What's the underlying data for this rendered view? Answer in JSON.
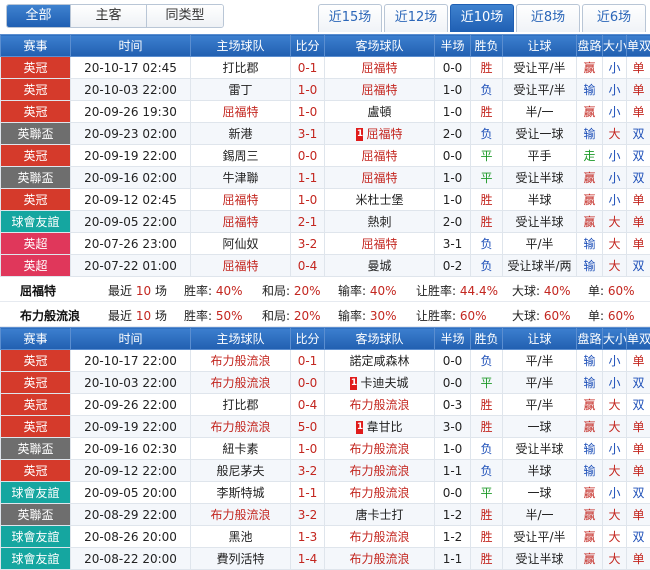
{
  "filters": {
    "scope": [
      "全部",
      "主客",
      "同类型"
    ],
    "active_scope": 0,
    "recent": [
      "近15场",
      "近12场",
      "近10场",
      "近8场",
      "近6场"
    ],
    "active_recent": 2
  },
  "headers": [
    "赛事",
    "时间",
    "主场球队",
    "比分",
    "客场球队",
    "半场",
    "胜负",
    "让球",
    "盘路",
    "大小",
    "单双"
  ],
  "colors": {
    "header_bg": "#2a6bbf",
    "league_red": "#d53a2b",
    "league_gray": "#6e6e6e",
    "league_teal": "#15a6a0",
    "league_pink": "#e0375b",
    "win_red": "#c3261f",
    "lose_blue": "#1d4fb8",
    "draw_green": "#1f9a2a"
  },
  "table1": [
    {
      "league": "英冠",
      "lc": "red",
      "time": "20-10-17 02:45",
      "home": "打比郡",
      "hc": "dark",
      "score": "0-1",
      "away": "屈福特",
      "ac": "red",
      "ht": "0-0",
      "res": "胜",
      "handicap": "受让平/半",
      "pan": "赢",
      "ou": "小",
      "oe": "单"
    },
    {
      "league": "英冠",
      "lc": "red",
      "time": "20-10-03 22:00",
      "home": "雷丁",
      "hc": "dark",
      "score": "1-0",
      "away": "屈福特",
      "ac": "red",
      "ht": "1-0",
      "res": "负",
      "handicap": "受让平/半",
      "pan": "输",
      "ou": "小",
      "oe": "单"
    },
    {
      "league": "英冠",
      "lc": "red",
      "time": "20-09-26 19:30",
      "home": "屈福特",
      "hc": "red",
      "score": "1-0",
      "away": "盧頓",
      "ac": "dark",
      "ht": "1-0",
      "res": "胜",
      "handicap": "半/一",
      "pan": "赢",
      "ou": "小",
      "oe": "单"
    },
    {
      "league": "英聯盃",
      "lc": "gray",
      "time": "20-09-23 02:00",
      "home": "新港",
      "hc": "dark",
      "score": "3-1",
      "away": "屈福特",
      "ac": "red",
      "card": "1",
      "ht": "2-0",
      "res": "负",
      "handicap": "受让一球",
      "pan": "输",
      "ou": "大",
      "oe": "双"
    },
    {
      "league": "英冠",
      "lc": "red",
      "time": "20-09-19 22:00",
      "home": "錫周三",
      "hc": "dark",
      "score": "0-0",
      "away": "屈福特",
      "ac": "red",
      "ht": "0-0",
      "res": "平",
      "handicap": "平手",
      "pan": "走",
      "ou": "小",
      "oe": "双"
    },
    {
      "league": "英聯盃",
      "lc": "gray",
      "time": "20-09-16 02:00",
      "home": "牛津聯",
      "hc": "dark",
      "score": "1-1",
      "away": "屈福特",
      "ac": "red",
      "ht": "1-0",
      "res": "平",
      "handicap": "受让半球",
      "pan": "赢",
      "ou": "小",
      "oe": "双"
    },
    {
      "league": "英冠",
      "lc": "red",
      "time": "20-09-12 02:45",
      "home": "屈福特",
      "hc": "red",
      "score": "1-0",
      "away": "米杜士堡",
      "ac": "dark",
      "ht": "1-0",
      "res": "胜",
      "handicap": "半球",
      "pan": "赢",
      "ou": "小",
      "oe": "单"
    },
    {
      "league": "球會友誼",
      "lc": "teal",
      "time": "20-09-05 22:00",
      "home": "屈福特",
      "hc": "red",
      "score": "2-1",
      "away": "熱刺",
      "ac": "dark",
      "ht": "2-0",
      "res": "胜",
      "handicap": "受让半球",
      "pan": "赢",
      "ou": "大",
      "oe": "单"
    },
    {
      "league": "英超",
      "lc": "pink",
      "time": "20-07-26 23:00",
      "home": "阿仙奴",
      "hc": "dark",
      "score": "3-2",
      "away": "屈福特",
      "ac": "red",
      "ht": "3-1",
      "res": "负",
      "handicap": "平/半",
      "pan": "输",
      "ou": "大",
      "oe": "单"
    },
    {
      "league": "英超",
      "lc": "pink",
      "time": "20-07-22 01:00",
      "home": "屈福特",
      "hc": "red",
      "score": "0-4",
      "away": "曼城",
      "ac": "dark",
      "ht": "0-2",
      "res": "负",
      "handicap": "受让球半/两",
      "pan": "输",
      "ou": "大",
      "oe": "双"
    }
  ],
  "summary1": {
    "team": "屈福特",
    "recent_label": "最近",
    "recent_n": "10",
    "recent_unit": "场",
    "win_label": "胜率:",
    "win": "40%",
    "draw_label": "和局:",
    "draw": "20%",
    "lose_label": "输率:",
    "lose": "40%",
    "ah_label": "让胜率:",
    "ah": "44.4%",
    "big_label": "大球:",
    "big": "40%",
    "odd_label": "单:",
    "odd": "60%"
  },
  "summary2": {
    "team": "布力般流浪",
    "recent_label": "最近",
    "recent_n": "10",
    "recent_unit": "场",
    "win_label": "胜率:",
    "win": "50%",
    "draw_label": "和局:",
    "draw": "20%",
    "lose_label": "输率:",
    "lose": "30%",
    "ah_label": "让胜率:",
    "ah": "60%",
    "big_label": "大球:",
    "big": "60%",
    "odd_label": "单:",
    "odd": "60%"
  },
  "table2": [
    {
      "league": "英冠",
      "lc": "red",
      "time": "20-10-17 22:00",
      "home": "布力般流浪",
      "hc": "red",
      "score": "0-1",
      "away": "諾定咸森林",
      "ac": "dark",
      "ht": "0-0",
      "res": "负",
      "handicap": "平/半",
      "pan": "输",
      "ou": "小",
      "oe": "单"
    },
    {
      "league": "英冠",
      "lc": "red",
      "time": "20-10-03 22:00",
      "home": "布力般流浪",
      "hc": "red",
      "score": "0-0",
      "away": "卡迪夫城",
      "ac": "dark",
      "card": "1",
      "ht": "0-0",
      "res": "平",
      "handicap": "平/半",
      "pan": "输",
      "ou": "小",
      "oe": "双"
    },
    {
      "league": "英冠",
      "lc": "red",
      "time": "20-09-26 22:00",
      "home": "打比郡",
      "hc": "dark",
      "score": "0-4",
      "away": "布力般流浪",
      "ac": "red",
      "ht": "0-3",
      "res": "胜",
      "handicap": "平/半",
      "pan": "赢",
      "ou": "大",
      "oe": "双"
    },
    {
      "league": "英冠",
      "lc": "red",
      "time": "20-09-19 22:00",
      "home": "布力般流浪",
      "hc": "red",
      "score": "5-0",
      "away": "韋甘比",
      "ac": "dark",
      "card": "1",
      "ht": "3-0",
      "res": "胜",
      "handicap": "一球",
      "pan": "赢",
      "ou": "大",
      "oe": "单"
    },
    {
      "league": "英聯盃",
      "lc": "gray",
      "time": "20-09-16 02:30",
      "home": "紐卡素",
      "hc": "dark",
      "score": "1-0",
      "away": "布力般流浪",
      "ac": "red",
      "ht": "1-0",
      "res": "负",
      "handicap": "受让半球",
      "pan": "输",
      "ou": "小",
      "oe": "单"
    },
    {
      "league": "英冠",
      "lc": "red",
      "time": "20-09-12 22:00",
      "home": "般尼茅夫",
      "hc": "dark",
      "score": "3-2",
      "away": "布力般流浪",
      "ac": "red",
      "ht": "1-1",
      "res": "负",
      "handicap": "半球",
      "pan": "输",
      "ou": "大",
      "oe": "单"
    },
    {
      "league": "球會友誼",
      "lc": "teal",
      "time": "20-09-05 20:00",
      "home": "李斯特城",
      "hc": "dark",
      "score": "1-1",
      "away": "布力般流浪",
      "ac": "red",
      "ht": "0-0",
      "res": "平",
      "handicap": "一球",
      "pan": "赢",
      "ou": "小",
      "oe": "双"
    },
    {
      "league": "英聯盃",
      "lc": "gray",
      "time": "20-08-29 22:00",
      "home": "布力般流浪",
      "hc": "red",
      "score": "3-2",
      "away": "唐卡士打",
      "ac": "dark",
      "ht": "1-2",
      "res": "胜",
      "handicap": "半/一",
      "pan": "赢",
      "ou": "大",
      "oe": "单"
    },
    {
      "league": "球會友誼",
      "lc": "teal",
      "time": "20-08-26 20:00",
      "home": "黑池",
      "hc": "dark",
      "score": "1-3",
      "away": "布力般流浪",
      "ac": "red",
      "ht": "1-2",
      "res": "胜",
      "handicap": "受让平/半",
      "pan": "赢",
      "ou": "大",
      "oe": "双"
    },
    {
      "league": "球會友誼",
      "lc": "teal",
      "time": "20-08-22 20:00",
      "home": "費列活特",
      "hc": "dark",
      "score": "1-4",
      "away": "布力般流浪",
      "ac": "red",
      "ht": "1-1",
      "res": "胜",
      "handicap": "受让半球",
      "pan": "赢",
      "ou": "大",
      "oe": "单"
    }
  ]
}
